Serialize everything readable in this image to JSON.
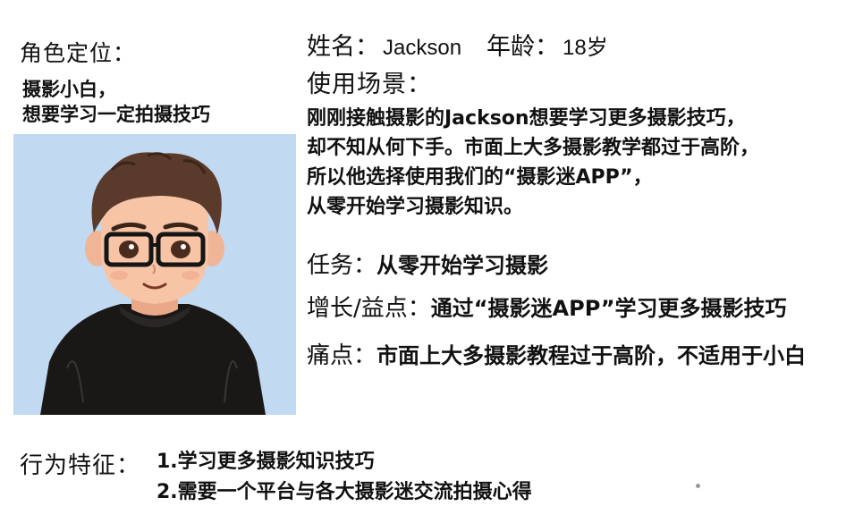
{
  "role": {
    "label": "角色定位：",
    "desc_lines": [
      "摄影小白，",
      "想要学习一定拍摄技巧"
    ]
  },
  "avatar": {
    "icon": "cartoon-boy-with-glasses-avatar",
    "background": "#c2d9f2"
  },
  "profile": {
    "name_label": "姓名：",
    "name_value": "Jackson",
    "age_label": "年龄：",
    "age_value": "18岁"
  },
  "scene": {
    "label": "使用场景：",
    "lines": [
      "刚刚接触摄影的Jackson想要学习更多摄影技巧，",
      "却不知从何下手。市面上大多摄影教学都过于高阶，",
      "所以他选择使用我们的“摄影迷APP”，",
      "从零开始学习摄影知识。"
    ]
  },
  "task": {
    "label": "任务：",
    "value": "从零开始学习摄影"
  },
  "benefit": {
    "label": "增长/益点：",
    "value": "通过“摄影迷APP”学习更多摄影技巧"
  },
  "pain": {
    "label": "痛点：",
    "value": "市面上大多摄影教程过于高阶，不适用于小白"
  },
  "behavior": {
    "label": "行为特征：",
    "items": [
      "1.学习更多摄影知识技巧",
      "2.需要一个平台与各大摄影迷交流拍摄心得"
    ]
  }
}
